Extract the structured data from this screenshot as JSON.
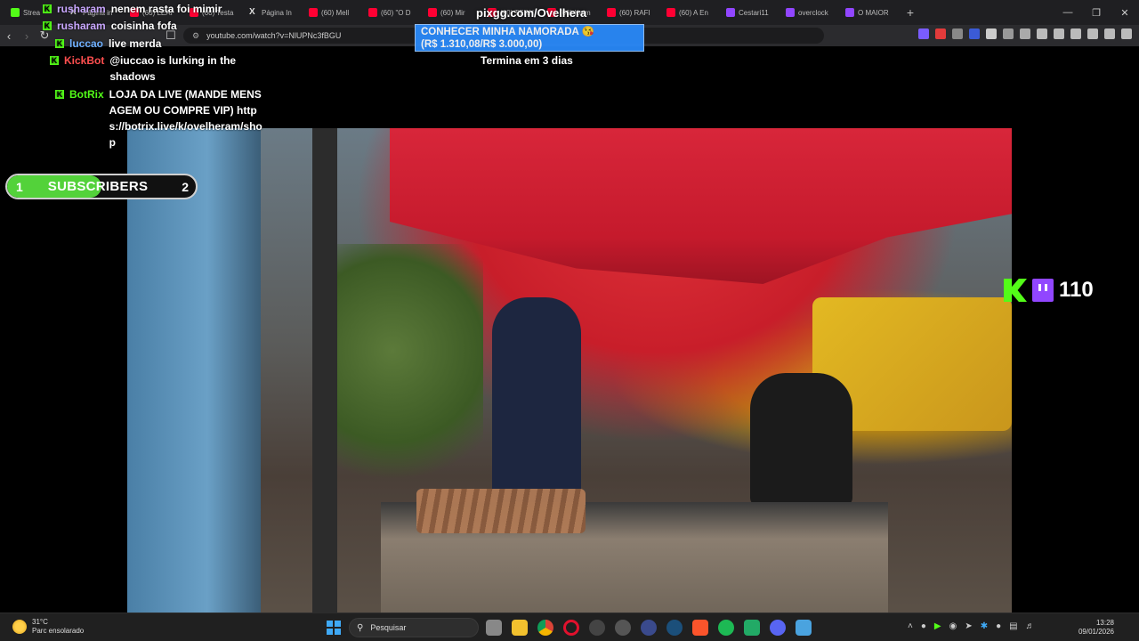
{
  "browser": {
    "tabs": [
      {
        "label": "Strea",
        "icon": "kick-icon"
      },
      {
        "label": "Página in",
        "icon": "x-icon"
      },
      {
        "label": "(60) LEAI",
        "icon": "youtube-icon"
      },
      {
        "label": "(60) Testa",
        "icon": "youtube-icon"
      },
      {
        "label": "Página In",
        "icon": "x-icon"
      },
      {
        "label": "(60) Mell",
        "icon": "youtube-icon"
      },
      {
        "label": "(60) \"O D",
        "icon": "youtube-icon"
      },
      {
        "label": "(60) Mir",
        "icon": "youtube-icon"
      },
      {
        "label": "(60) TERN",
        "icon": "youtube-icon"
      },
      {
        "label": "(60) Keim",
        "icon": "youtube-icon"
      },
      {
        "label": "(60) RAFI",
        "icon": "youtube-icon"
      },
      {
        "label": "(60) A En",
        "icon": "youtube-icon"
      },
      {
        "label": "Cestari11",
        "icon": "twitch-icon"
      },
      {
        "label": "overclock",
        "icon": "twitch-icon"
      },
      {
        "label": "O MAIOR",
        "icon": "twitch-icon"
      }
    ],
    "new_tab": "+",
    "url": "youtube.com/watch?v=NlUPNc3fBGU"
  },
  "chat": [
    {
      "user": "rusharam",
      "user_color": "#c9a7ff",
      "text": "nenem rasta foi mimir"
    },
    {
      "user": "rusharam",
      "user_color": "#c9a7ff",
      "text": "coisinha fofa"
    },
    {
      "user": "luccao",
      "user_color": "#6fb0ff",
      "text": "live merda"
    },
    {
      "user": "KickBot",
      "user_color": "#ff4f4f",
      "text": "@iuccao is lurking in the shadows"
    },
    {
      "user": "BotRix",
      "user_color": "#53fc18",
      "text": "LOJA DA LIVE (MANDE MENSAGEM OU COMPRE VIP) https://botrix.live/k/ovelheram/shop"
    }
  ],
  "subs": {
    "current": "1",
    "label": "SUBSCRIBERS",
    "goal": "2",
    "progress": 0.5
  },
  "pix": {
    "title": "pixgg.com/Ovelhera",
    "goal_line1": "CONHECER MINHA NAMORADA 😘",
    "goal_line2": "(R$ 1.310,08/R$ 3.000,00)",
    "goal_progress": 0.437,
    "ends": "Termina em 3 dias"
  },
  "viewers": {
    "count": "110"
  },
  "taskbar": {
    "temp": "31°C",
    "weather": "Parc ensolarado",
    "search": "Pesquisar",
    "time": "13:28",
    "date": "09/01/2026"
  },
  "colors": {
    "kick": "#53fc18",
    "twitch": "#9146ff",
    "youtube": "#ff0033",
    "goal_bg": "#2a8cff"
  }
}
